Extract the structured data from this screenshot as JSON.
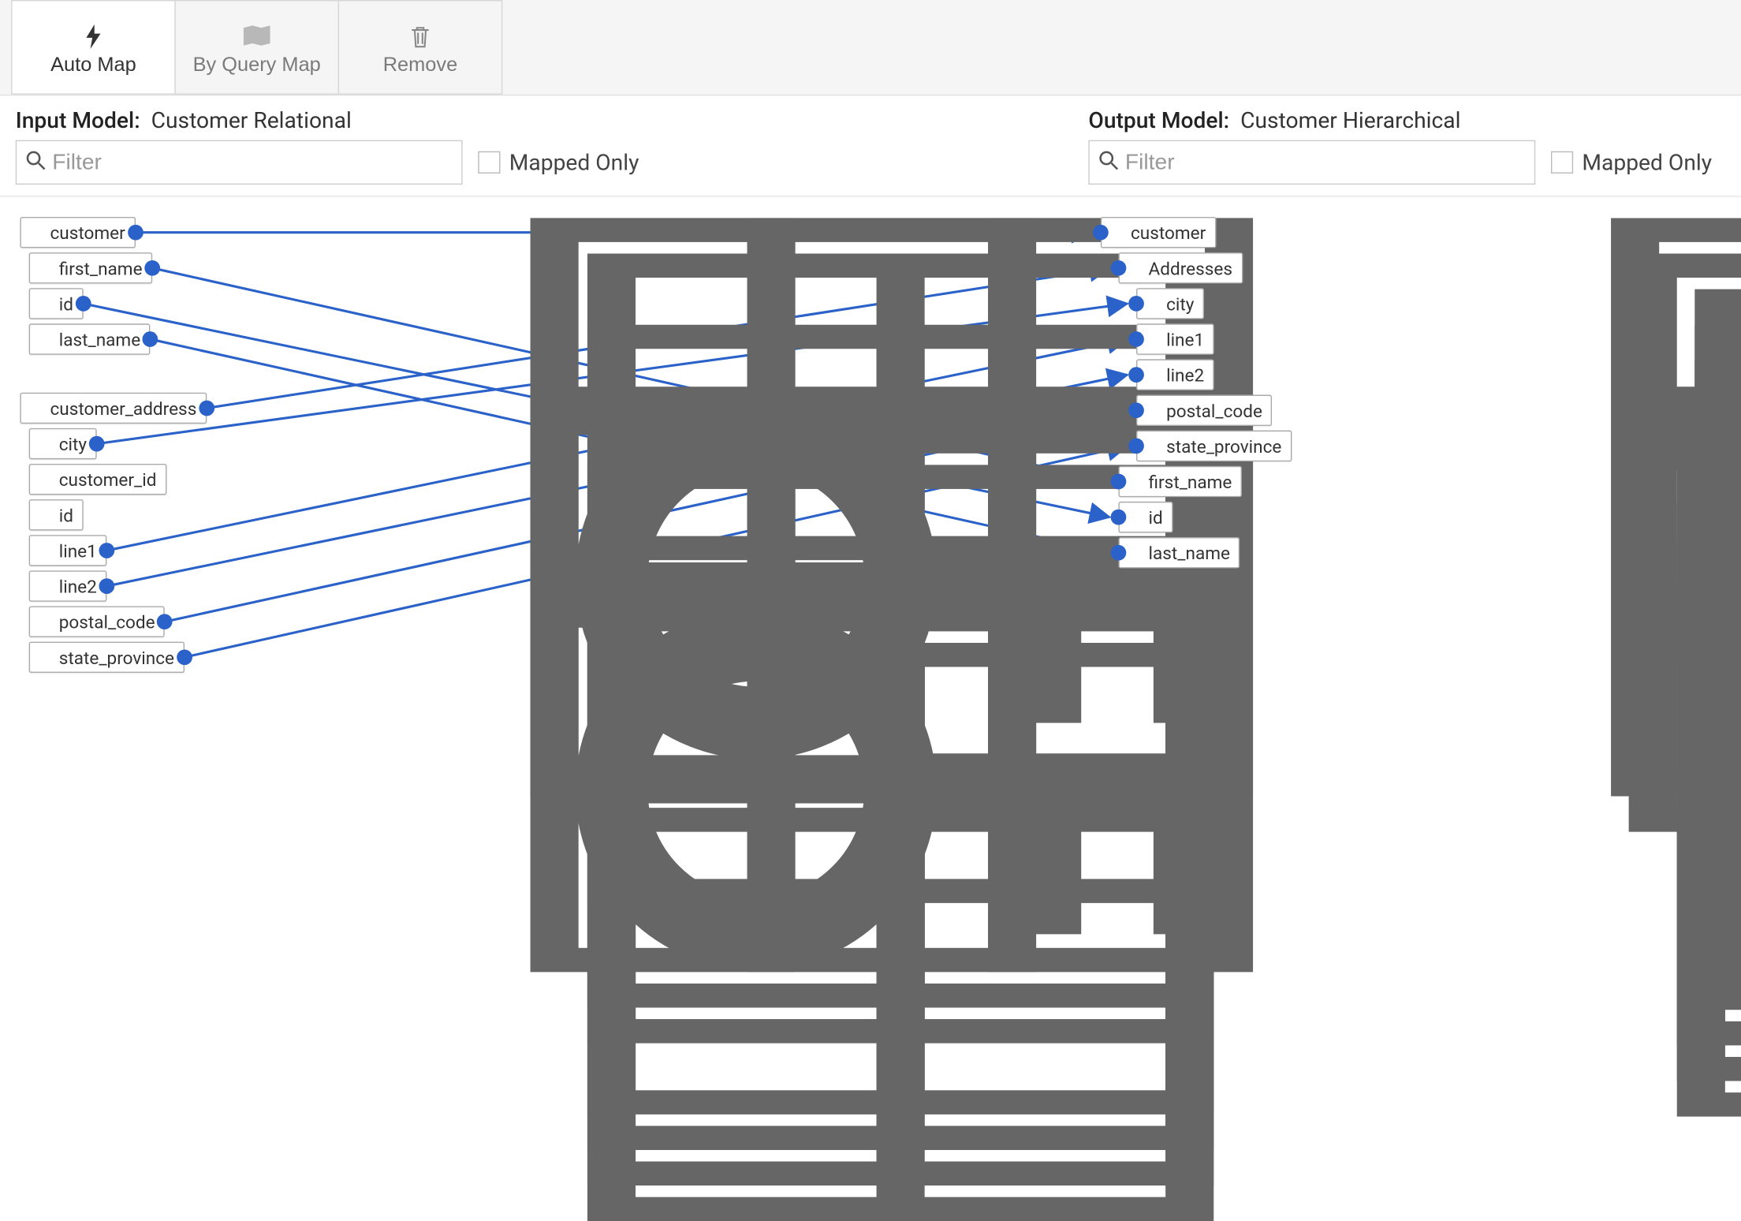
{
  "toolbar": {
    "auto_map": "Auto Map",
    "by_query": "By Query Map",
    "remove": "Remove"
  },
  "input": {
    "panel_label": "Input Model:",
    "model_name": "Customer Relational",
    "filter_placeholder": "Filter",
    "mapped_only_label": "Mapped Only"
  },
  "output": {
    "panel_label": "Output Model:",
    "model_name": "Customer Hierarchical",
    "filter_placeholder": "Filter",
    "mapped_only_label": "Mapped Only"
  },
  "input_nodes": {
    "customer": {
      "label": "customer",
      "icon": "table",
      "port": true
    },
    "first_name": {
      "label": "first_name",
      "icon": "col",
      "port": true
    },
    "id": {
      "label": "id",
      "icon": "key",
      "port": true
    },
    "last_name": {
      "label": "last_name",
      "icon": "col",
      "port": true
    },
    "customer_address": {
      "label": "customer_address",
      "icon": "table",
      "port": true
    },
    "city": {
      "label": "city",
      "icon": "col",
      "port": true
    },
    "customer_id": {
      "label": "customer_id",
      "icon": "col",
      "port": false
    },
    "addr_id": {
      "label": "id",
      "icon": "key",
      "port": false
    },
    "line1": {
      "label": "line1",
      "icon": "col",
      "port": true
    },
    "line2": {
      "label": "line2",
      "icon": "col",
      "port": true
    },
    "postal_code": {
      "label": "postal_code",
      "icon": "col",
      "port": true
    },
    "state_province": {
      "label": "state_province",
      "icon": "col",
      "port": true
    }
  },
  "output_nodes": {
    "customer": {
      "label": "customer",
      "icon": "table"
    },
    "Addresses": {
      "label": "Addresses",
      "icon": "table"
    },
    "city": {
      "label": "city",
      "icon": "col"
    },
    "line1": {
      "label": "line1",
      "icon": "col"
    },
    "line2": {
      "label": "line2",
      "icon": "col"
    },
    "postal_code": {
      "label": "postal_code",
      "icon": "col"
    },
    "state_province": {
      "label": "state_province",
      "icon": "col"
    },
    "first_name": {
      "label": "first_name",
      "icon": "col"
    },
    "id": {
      "label": "id",
      "icon": "col"
    },
    "last_name": {
      "label": "last_name",
      "icon": "col"
    }
  },
  "links": [
    {
      "from": "customer",
      "to": "customer"
    },
    {
      "from": "first_name",
      "to": "first_name"
    },
    {
      "from": "id",
      "to": "id"
    },
    {
      "from": "last_name",
      "to": "last_name"
    },
    {
      "from": "customer_address",
      "to": "Addresses"
    },
    {
      "from": "city",
      "to": "city"
    },
    {
      "from": "line1",
      "to": "line1"
    },
    {
      "from": "line2",
      "to": "line2"
    },
    {
      "from": "postal_code",
      "to": "postal_code"
    },
    {
      "from": "state_province",
      "to": "state_province"
    }
  ]
}
